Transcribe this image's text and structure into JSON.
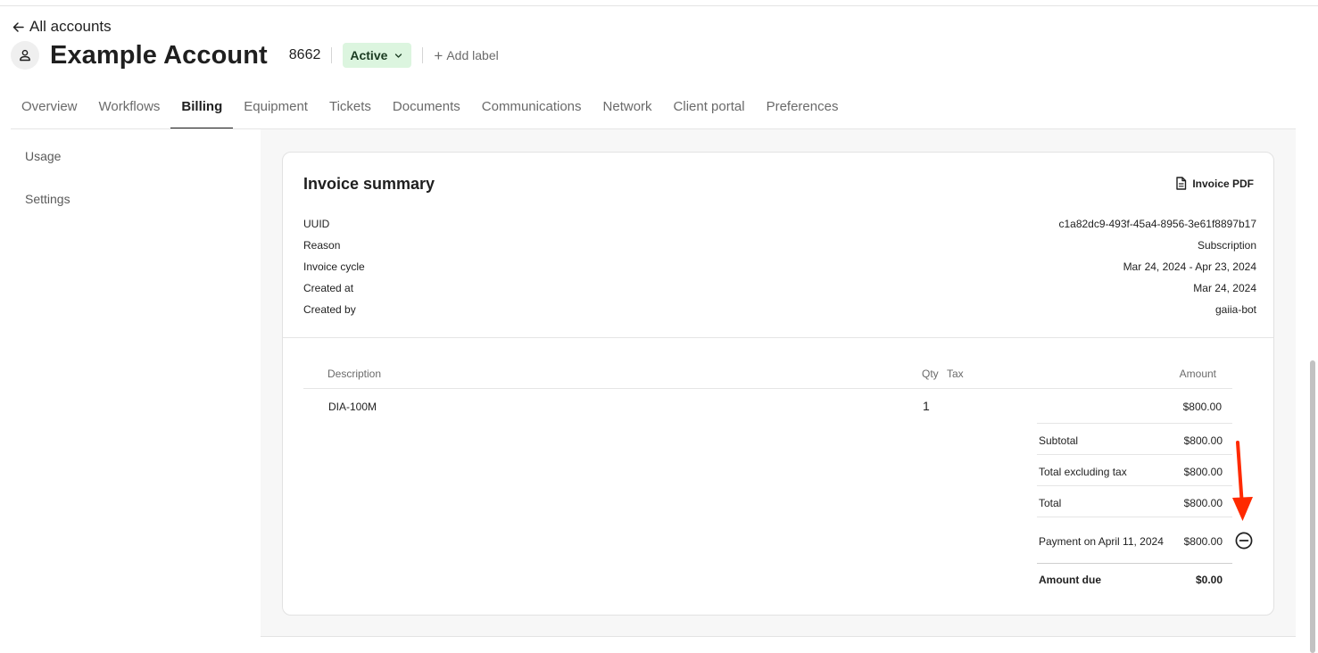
{
  "header": {
    "back_label": "All accounts",
    "account_name": "Example Account",
    "account_id": "8662",
    "status": "Active",
    "add_label": "Add label"
  },
  "tabs": [
    {
      "label": "Overview"
    },
    {
      "label": "Workflows"
    },
    {
      "label": "Billing",
      "active": true
    },
    {
      "label": "Equipment"
    },
    {
      "label": "Tickets"
    },
    {
      "label": "Documents"
    },
    {
      "label": "Communications"
    },
    {
      "label": "Network"
    },
    {
      "label": "Client portal"
    },
    {
      "label": "Preferences"
    }
  ],
  "sidebar": {
    "items": [
      {
        "label": "Usage"
      },
      {
        "label": "Settings"
      }
    ]
  },
  "invoice": {
    "title": "Invoice summary",
    "pdf_label": "Invoice PDF",
    "meta": [
      {
        "label": "UUID",
        "value": "c1a82dc9-493f-45a4-8956-3e61f8897b17"
      },
      {
        "label": "Reason",
        "value": "Subscription"
      },
      {
        "label": "Invoice cycle",
        "value": "Mar 24, 2024 - Apr 23, 2024"
      },
      {
        "label": "Created at",
        "value": "Mar 24, 2024"
      },
      {
        "label": "Created by",
        "value": "gaiia-bot"
      }
    ],
    "columns": {
      "description": "Description",
      "qty": "Qty",
      "tax": "Tax",
      "amount": "Amount"
    },
    "line_items": [
      {
        "description": "DIA-100M",
        "qty": "1",
        "tax": "",
        "amount": "$800.00"
      }
    ],
    "totals": {
      "subtotal_label": "Subtotal",
      "subtotal": "$800.00",
      "excl_tax_label": "Total excluding tax",
      "excl_tax": "$800.00",
      "total_label": "Total",
      "total": "$800.00",
      "payment_label": "Payment on April 11, 2024",
      "payment": "$800.00",
      "amount_due_label": "Amount due",
      "amount_due": "$0.00"
    }
  },
  "colors": {
    "status_bg": "#dcf5df",
    "annotation_arrow": "#ff2a00",
    "active_tab_underline": "#1f1f1f"
  },
  "icons": {
    "back": "arrow-left-icon",
    "avatar": "person-icon",
    "status_toggle": "chevron-down-icon",
    "pdf": "document-icon",
    "remove_payment": "minus-circle-icon"
  }
}
